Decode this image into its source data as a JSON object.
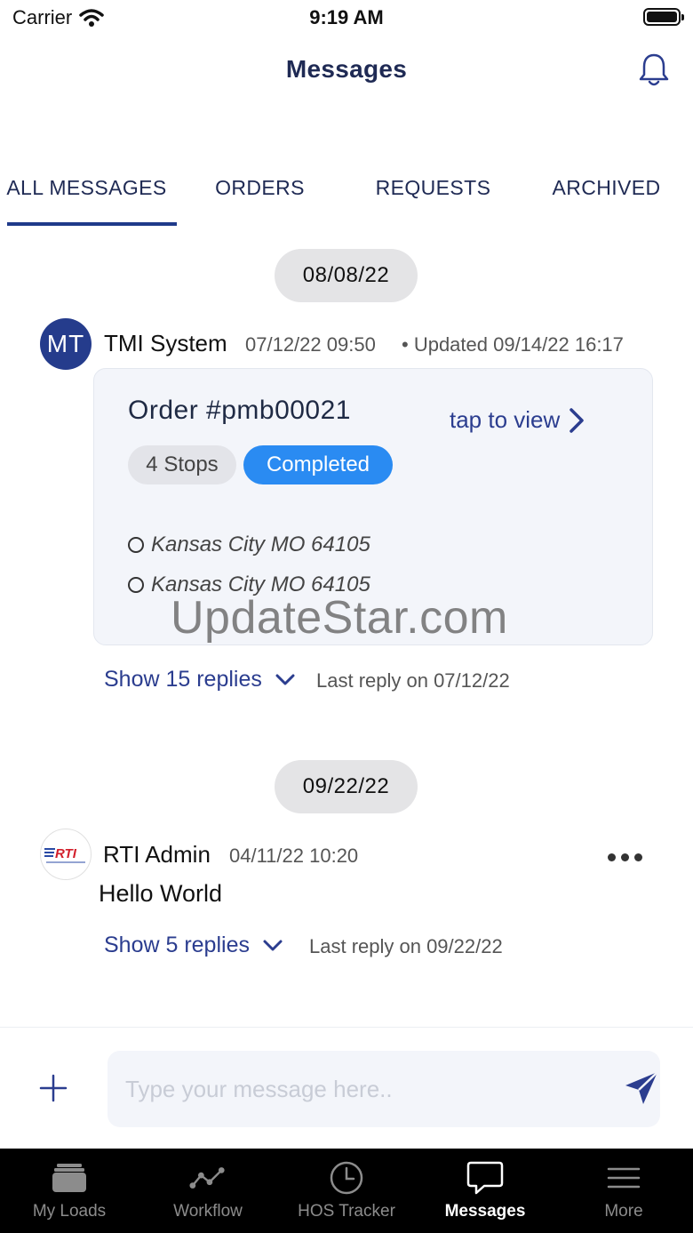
{
  "status_bar": {
    "carrier": "Carrier",
    "time": "9:19 AM"
  },
  "header": {
    "title": "Messages"
  },
  "tabs": [
    {
      "label": "ALL MESSAGES",
      "active": true
    },
    {
      "label": "ORDERS",
      "active": false
    },
    {
      "label": "REQUESTS",
      "active": false
    },
    {
      "label": "ARCHIVED",
      "active": false
    }
  ],
  "groups": [
    {
      "date": "08/08/22",
      "message": {
        "avatar_initials": "MT",
        "sender": "TMI System",
        "timestamp": "07/12/22 09:50",
        "updated": "• Updated 09/14/22 16:17",
        "order": {
          "title": "Order #pmb00021",
          "tap_label": "tap to view",
          "stops_badge": "4 Stops",
          "status_badge": "Completed",
          "stops": [
            "Kansas City MO 64105",
            "Kansas City MO 64105"
          ]
        },
        "replies_label": "Show 15 replies",
        "last_reply": "Last reply on 07/12/22"
      }
    },
    {
      "date": "09/22/22",
      "message": {
        "avatar_text": "RTI",
        "sender": "RTI Admin",
        "timestamp": "04/11/22 10:20",
        "body": "Hello World",
        "replies_label": "Show 5 replies",
        "last_reply": "Last reply on 09/22/22"
      }
    }
  ],
  "watermark": "UpdateStar.com",
  "compose": {
    "placeholder": "Type your message here.."
  },
  "tabbar": [
    {
      "label": "My Loads",
      "icon": "stack-icon",
      "active": false
    },
    {
      "label": "Workflow",
      "icon": "workflow-icon",
      "active": false
    },
    {
      "label": "HOS Tracker",
      "icon": "clock-icon",
      "active": false
    },
    {
      "label": "Messages",
      "icon": "chat-icon",
      "active": true
    },
    {
      "label": "More",
      "icon": "menu-icon",
      "active": false
    }
  ],
  "colors": {
    "accent": "#253c8c",
    "link": "#2b3d8f",
    "completed": "#2a8bf2",
    "card_bg": "#f3f5fa"
  }
}
